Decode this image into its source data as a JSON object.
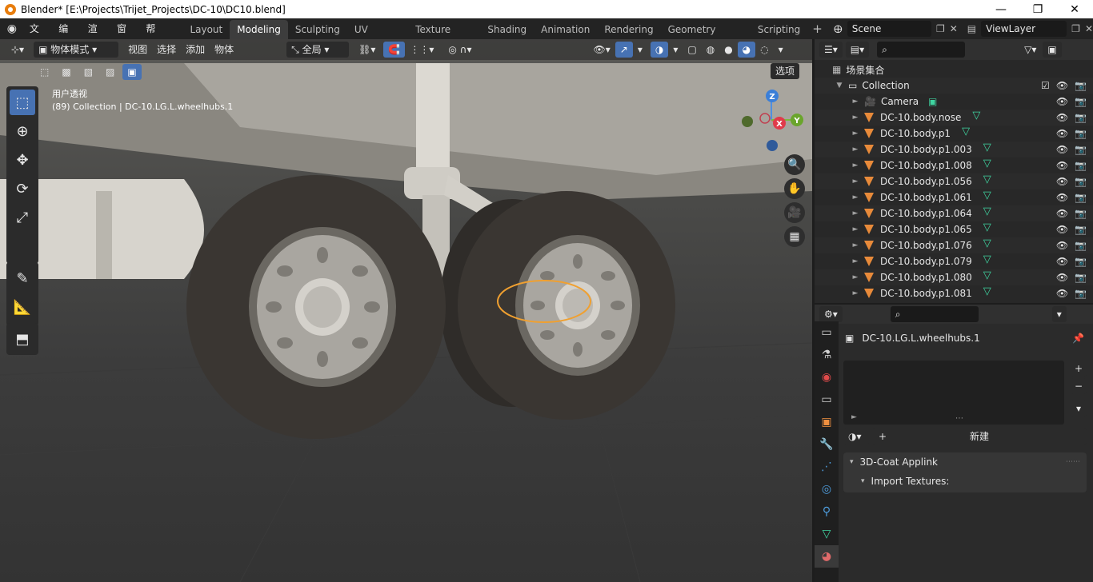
{
  "window": {
    "title": "Blender* [E:\\Projects\\Trijet_Projects\\DC-10\\DC10.blend]",
    "minimize": "—",
    "maximize": "❐",
    "close": "✕"
  },
  "menu": {
    "items": [
      "文件",
      "编辑",
      "渲染",
      "窗口",
      "帮助"
    ]
  },
  "workspaces": [
    "Layout",
    "Modeling",
    "Sculpting",
    "UV Editing",
    "Texture Paint",
    "Shading",
    "Animation",
    "Rendering",
    "Geometry Nodes",
    "Scripting"
  ],
  "active_workspace": "Modeling",
  "scene": {
    "name": "Scene",
    "view_layer": "ViewLayer"
  },
  "viewport_header": {
    "mode": "物体模式",
    "menus": [
      "视图",
      "选择",
      "添加",
      "物体"
    ],
    "orientation": "全局",
    "options": "选项"
  },
  "viewport": {
    "view_name": "用户透视",
    "object_info": "(89) Collection | DC-10.LG.L.wheelhubs.1",
    "gizmo": {
      "z": "Z",
      "x": "X",
      "y": "Y"
    }
  },
  "outliner": {
    "root": "场景集合",
    "collection": "Collection",
    "rows": [
      {
        "name": "Camera",
        "type": "camera"
      },
      {
        "name": "DC-10.body.nose",
        "type": "mesh"
      },
      {
        "name": "DC-10.body.p1",
        "type": "mesh"
      },
      {
        "name": "DC-10.body.p1.003",
        "type": "mesh"
      },
      {
        "name": "DC-10.body.p1.008",
        "type": "mesh"
      },
      {
        "name": "DC-10.body.p1.056",
        "type": "mesh"
      },
      {
        "name": "DC-10.body.p1.061",
        "type": "mesh"
      },
      {
        "name": "DC-10.body.p1.064",
        "type": "mesh"
      },
      {
        "name": "DC-10.body.p1.065",
        "type": "mesh"
      },
      {
        "name": "DC-10.body.p1.076",
        "type": "mesh"
      },
      {
        "name": "DC-10.body.p1.079",
        "type": "mesh"
      },
      {
        "name": "DC-10.body.p1.080",
        "type": "mesh"
      },
      {
        "name": "DC-10.body.p1.081",
        "type": "mesh"
      }
    ]
  },
  "properties": {
    "object_name": "DC-10.LG.L.wheelhubs.1",
    "new_label": "新建",
    "plus": "+",
    "minus": "−",
    "panel_title": "3D-Coat Applink",
    "sub_panel": "Import Textures:"
  },
  "colors": {
    "accent": "#4772b3",
    "selection_outline": "#f0a030",
    "mesh_icon": "#e88a3a",
    "data_icon": "#3fd4a0"
  }
}
